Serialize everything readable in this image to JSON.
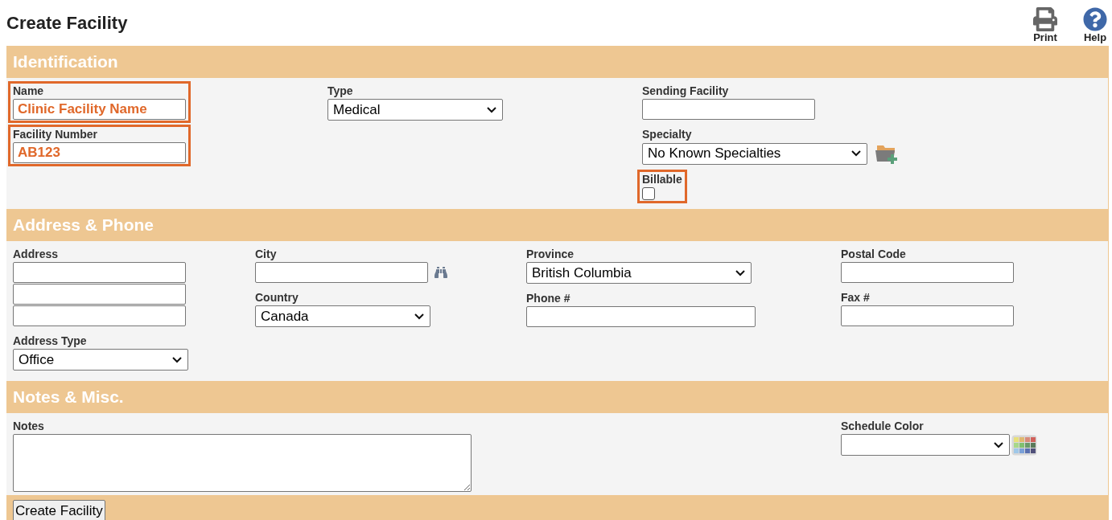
{
  "page_title": "Create Facility",
  "toolbar": [
    {
      "kind": "print",
      "label": "Print"
    },
    {
      "kind": "help",
      "label": "Help"
    }
  ],
  "sections": [
    {
      "title": "Identification",
      "kind": "identification",
      "columns": [
        [
          {
            "kind": "text",
            "label": "Name",
            "value": "Clinic Facility Name",
            "highlighted": true
          },
          {
            "kind": "text",
            "label": "Facility Number",
            "value": "AB123",
            "highlighted": true
          }
        ],
        [
          {
            "kind": "select",
            "label": "Type",
            "value": "Medical",
            "highlighted": false
          }
        ],
        [
          {
            "kind": "text",
            "label": "Sending Facility",
            "highlighted": false
          },
          {
            "kind": "select-add",
            "label": "Specialty",
            "value": "No Known Specialties",
            "highlighted": false
          },
          {
            "kind": "checkbox",
            "label": "Billable",
            "checked": false,
            "highlighted": true
          }
        ]
      ]
    },
    {
      "title": "Address & Phone",
      "kind": "address",
      "columns": [
        [
          {
            "kind": "address-lines",
            "label": "Address",
            "highlighted": false
          },
          {
            "kind": "select",
            "label": "Address Type",
            "value": "Office",
            "highlighted": false
          }
        ],
        [
          {
            "kind": "text-lookup",
            "label": "City",
            "highlighted": false
          },
          {
            "kind": "select",
            "label": "Country",
            "value": "Canada",
            "highlighted": false
          }
        ],
        [
          {
            "kind": "select-wide",
            "label": "Province",
            "value": "British Columbia",
            "highlighted": false
          },
          {
            "kind": "text-wide",
            "label": "Phone #",
            "highlighted": false
          }
        ],
        [
          {
            "kind": "text",
            "label": "Postal Code",
            "highlighted": false
          },
          {
            "kind": "text",
            "label": "Fax #",
            "highlighted": false
          }
        ]
      ]
    },
    {
      "title": "Notes & Misc.",
      "kind": "notes",
      "columns": [
        [
          {
            "kind": "textarea",
            "label": "Notes",
            "highlighted": false
          }
        ],
        [
          {
            "kind": "select-palette",
            "label": "Schedule Color",
            "highlighted": false
          }
        ]
      ]
    }
  ],
  "submit": {
    "label": "Create Facility"
  }
}
